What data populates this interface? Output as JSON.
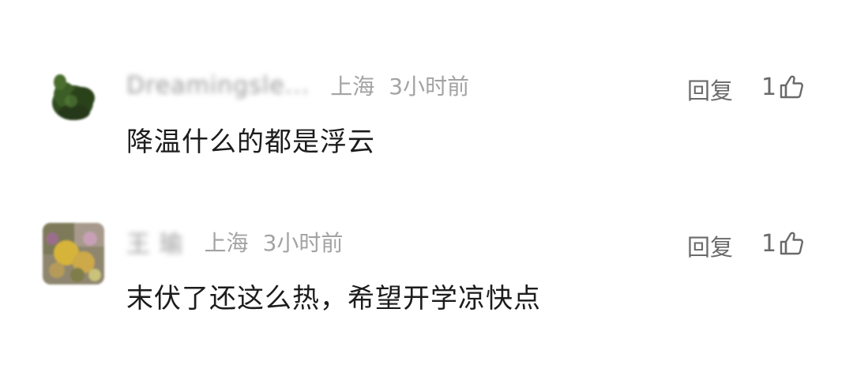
{
  "comments": [
    {
      "username": "Dreamingsle...",
      "location": "上海",
      "time": "3小时前",
      "text": "降温什么的都是浮云",
      "reply_label": "回复",
      "likes": "1",
      "avatar_icon": "green-plant-avatar"
    },
    {
      "username": "王 瑜",
      "location": "上海",
      "time": "3小时前",
      "text": "末伏了还这么热，希望开学凉快点",
      "reply_label": "回复",
      "likes": "1",
      "avatar_icon": "flower-photo-avatar"
    }
  ],
  "colors": {
    "meta_text": "#a3a3a3",
    "action_text": "#6a6a6a",
    "body_text": "#1c1c1c"
  }
}
